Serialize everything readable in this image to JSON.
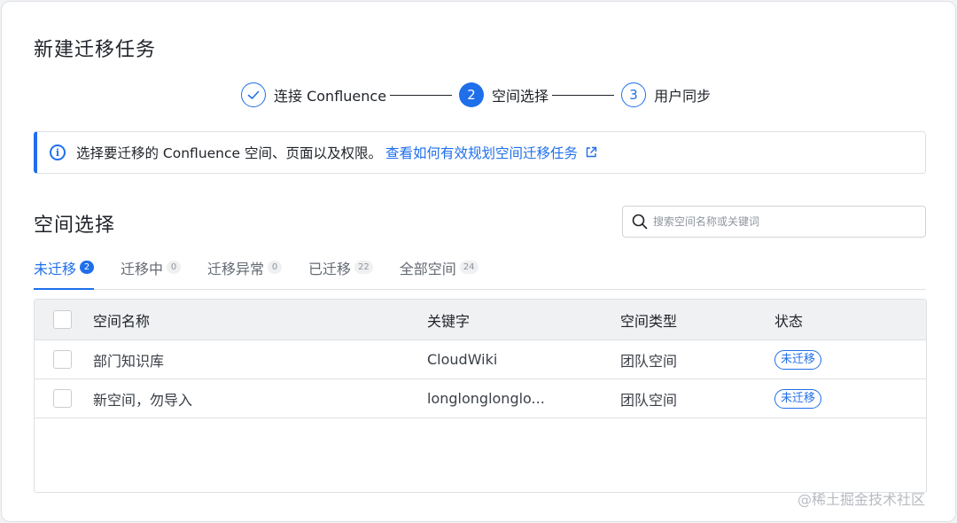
{
  "page_title": "新建迁移任务",
  "stepper": [
    {
      "number": "",
      "label": "连接 Confluence",
      "state": "done"
    },
    {
      "number": "2",
      "label": "空间选择",
      "state": "active"
    },
    {
      "number": "3",
      "label": "用户同步",
      "state": "todo"
    }
  ],
  "banner": {
    "text": "选择要迁移的 Confluence 空间、页面以及权限。",
    "link": "查看如何有效规划空间迁移任务",
    "accent_color": "#1f6feb"
  },
  "section": {
    "title": "空间选择",
    "search_placeholder": "搜索空间名称或关键词"
  },
  "tabs": [
    {
      "label": "未迁移",
      "count": "2",
      "active": true
    },
    {
      "label": "迁移中",
      "count": "0",
      "active": false
    },
    {
      "label": "迁移异常",
      "count": "0",
      "active": false
    },
    {
      "label": "已迁移",
      "count": "22",
      "active": false
    },
    {
      "label": "全部空间",
      "count": "24",
      "active": false
    }
  ],
  "table": {
    "headers": [
      "空间名称",
      "关键字",
      "空间类型",
      "状态"
    ],
    "rows": [
      {
        "name": "部门知识库",
        "key": "CloudWiki",
        "type": "团队空间",
        "status": "未迁移"
      },
      {
        "name": "新空间，勿导入",
        "key": "longlonglonglo...",
        "type": "团队空间",
        "status": "未迁移"
      }
    ]
  },
  "watermark": "@稀土掘金技术社区"
}
